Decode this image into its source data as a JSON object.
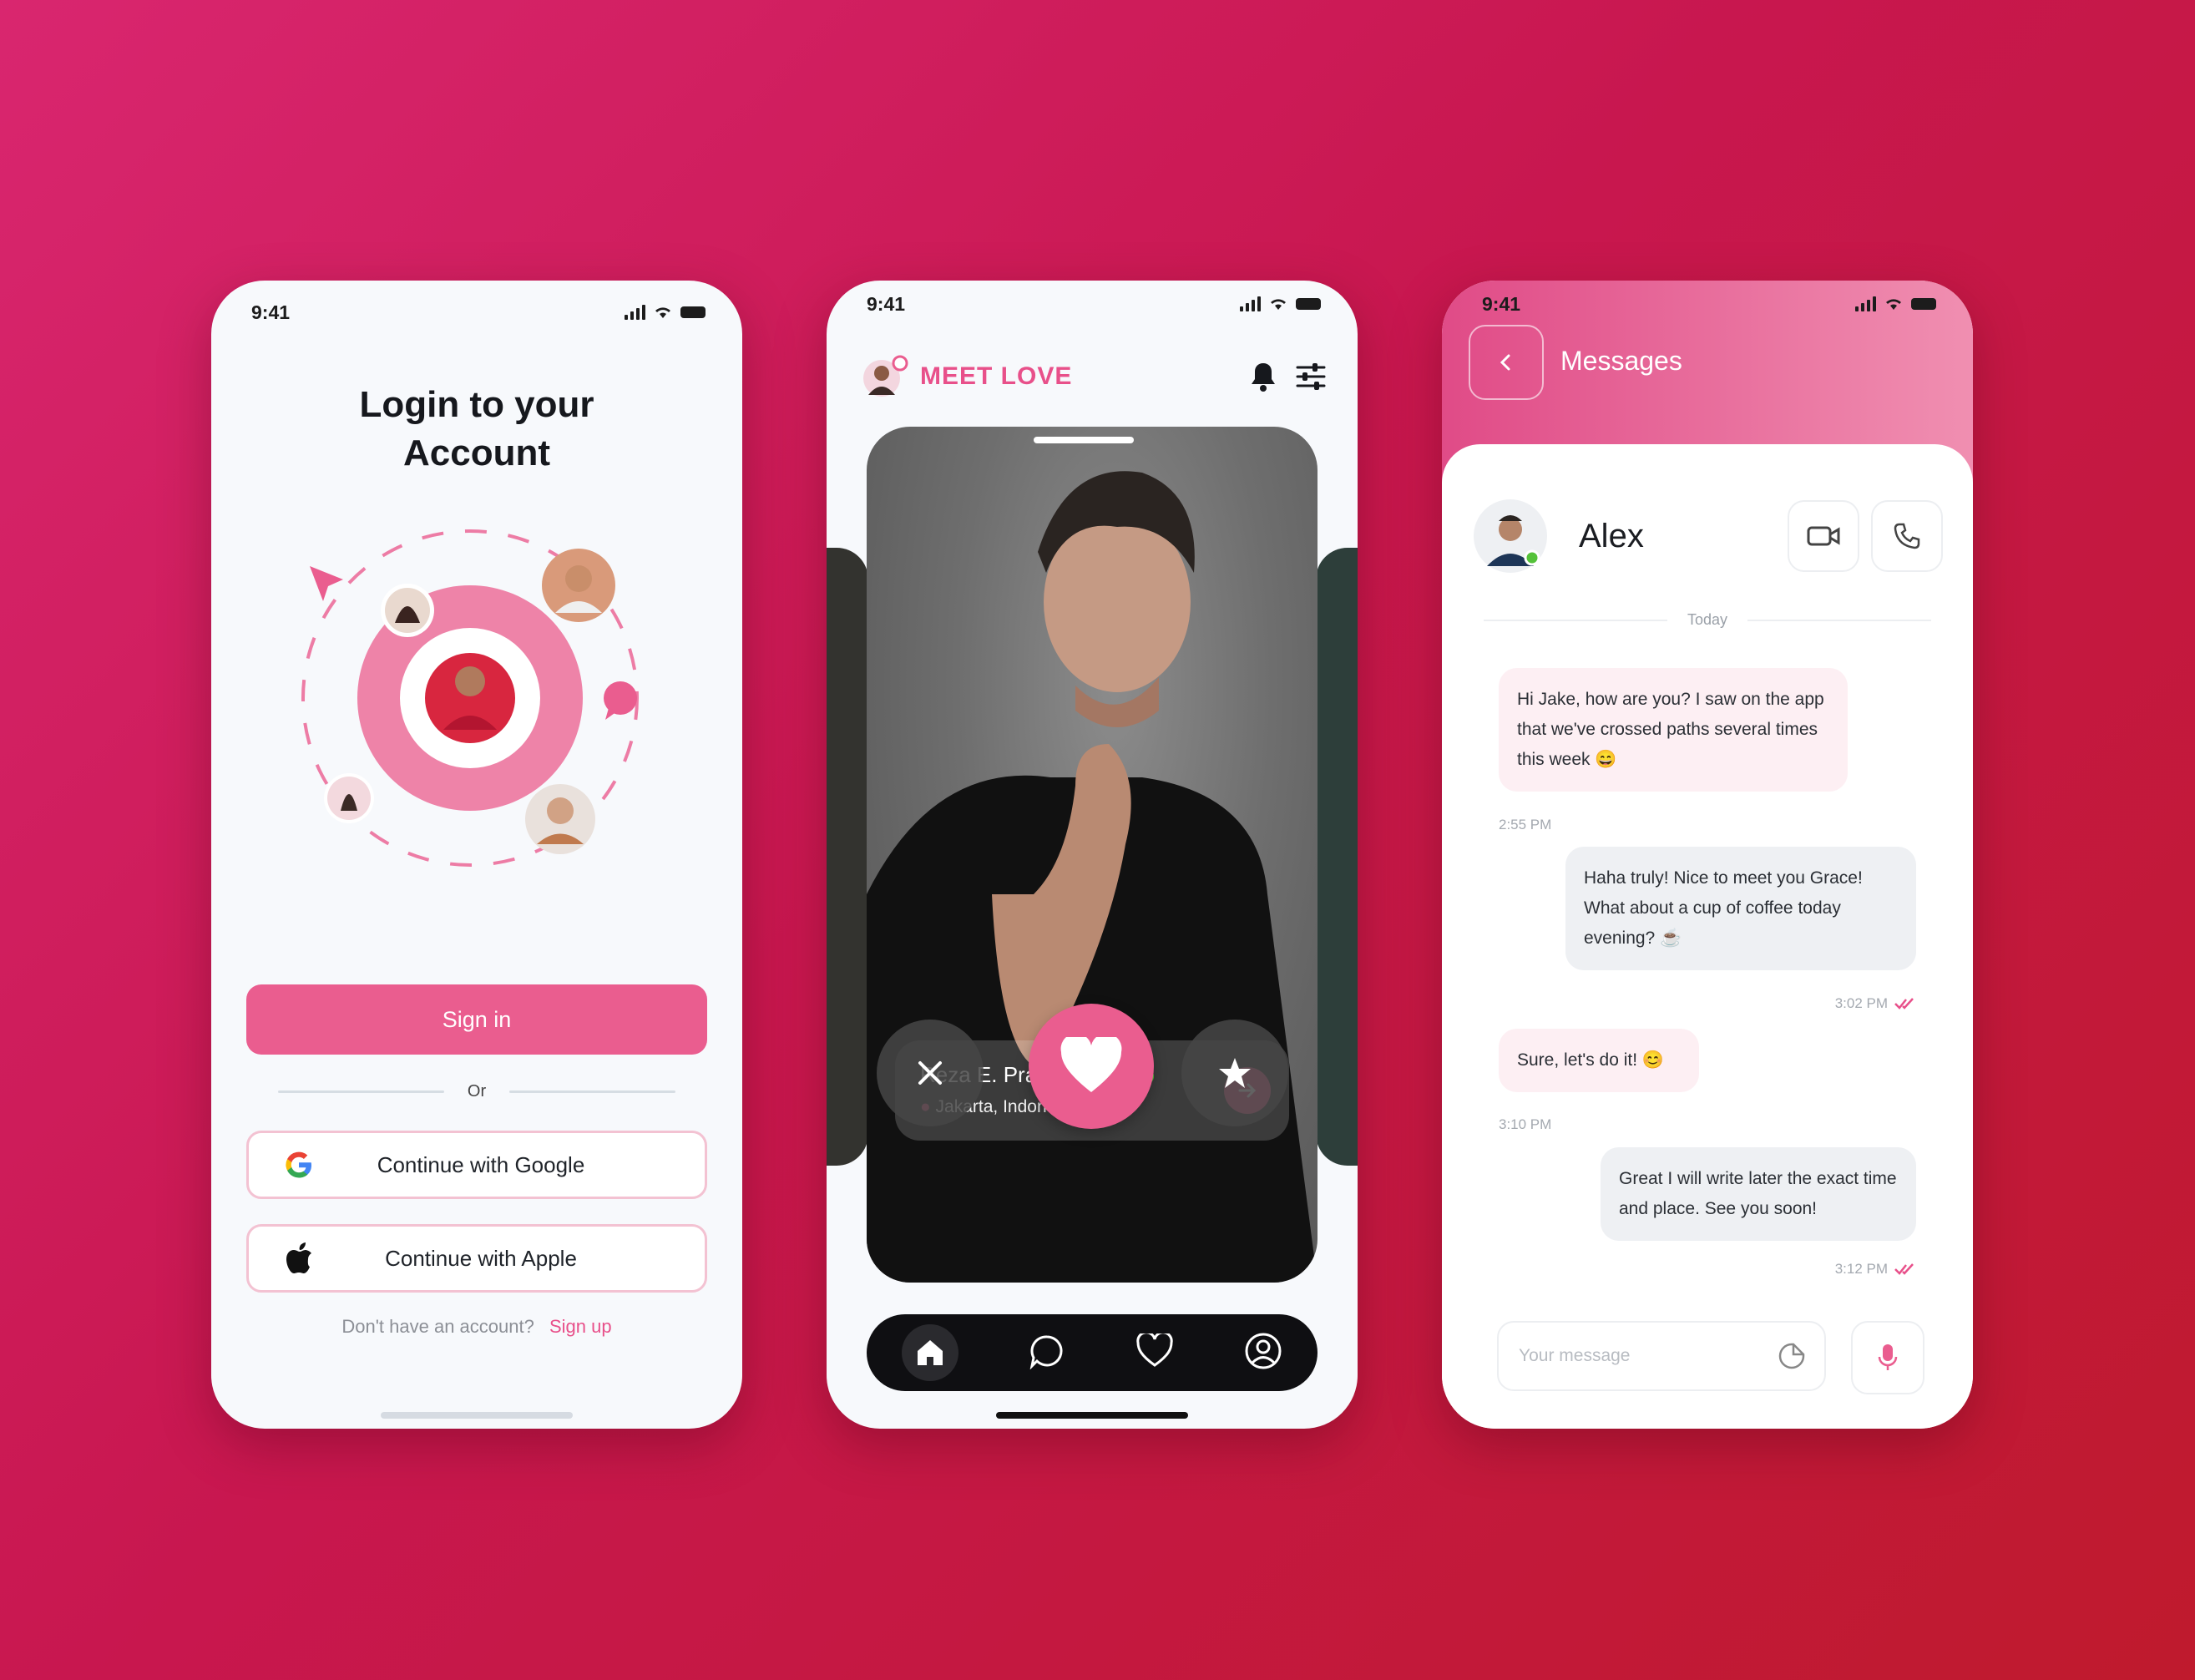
{
  "colors": {
    "accent": "#ea5d8f",
    "online": "#55c23a",
    "dark_nav": "#0f0f12"
  },
  "login_screen": {
    "status": {
      "time": "9:41"
    },
    "title_line1": "Login to your",
    "title_line2": "Account",
    "sign_in_label": "Sign in",
    "divider_text": "Or",
    "google_label": "Continue with Google",
    "apple_label": "Continue with Apple",
    "no_account_text": "Don't have an account?",
    "sign_up_label": "Sign up",
    "icons": [
      "send-icon",
      "chat-bubble-icon",
      "google-icon",
      "apple-icon"
    ]
  },
  "discover_screen": {
    "status": {
      "time": "9:41"
    },
    "app_name": "MEET LOVE",
    "profile": {
      "name_age": "Reza E. Prasetyo, 26",
      "location": "Jakarta, Indonesia",
      "online": true
    },
    "icons": [
      "bell-icon",
      "filter-sliders-icon",
      "close-icon",
      "heart-icon",
      "star-icon",
      "arrow-right-icon"
    ],
    "nav": [
      "home-icon",
      "chat-icon",
      "heart-icon",
      "profile-icon"
    ]
  },
  "chat_screen": {
    "status": {
      "time": "9:41"
    },
    "title": "Messages",
    "contact_name": "Alex",
    "day_label": "Today",
    "messages": [
      {
        "side": "in",
        "text": "Hi Jake, how are you? I saw on the app that we've crossed paths several times this week 😄",
        "time": "2:55 PM"
      },
      {
        "side": "out",
        "text": "Haha truly! Nice to meet you Grace! What about a cup of coffee today evening? ☕",
        "time": "3:02 PM"
      },
      {
        "side": "in",
        "text": "Sure, let's do it! 😊",
        "time": "3:10 PM"
      },
      {
        "side": "out",
        "text": "Great I will write later the exact time and place. See you soon!",
        "time": "3:12 PM"
      }
    ],
    "input_placeholder": "Your message",
    "icons": [
      "back-icon",
      "video-call-icon",
      "phone-icon",
      "sticker-icon",
      "mic-icon",
      "double-check-icon"
    ]
  }
}
